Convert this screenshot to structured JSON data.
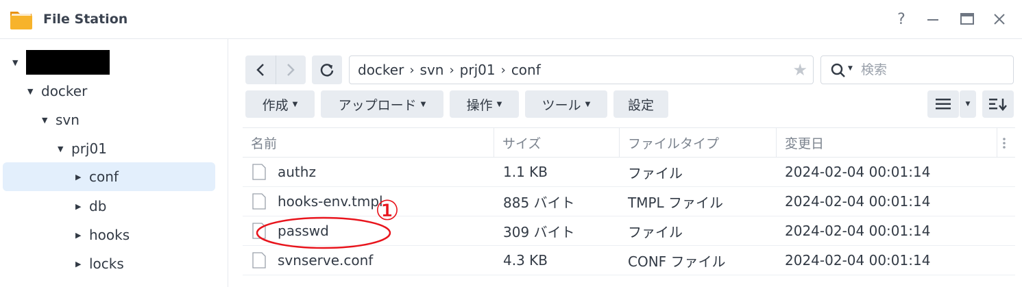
{
  "app": {
    "title": "File Station"
  },
  "window_controls": {
    "help": "?",
    "minimize": "—",
    "maximize": "□",
    "close": "✕"
  },
  "sidebar": {
    "root_label": "",
    "items": [
      {
        "label": "docker"
      },
      {
        "label": "svn"
      },
      {
        "label": "prj01"
      },
      {
        "label": "conf"
      },
      {
        "label": "db"
      },
      {
        "label": "hooks"
      },
      {
        "label": "locks"
      }
    ]
  },
  "path": {
    "segments": [
      "docker",
      "svn",
      "prj01",
      "conf"
    ]
  },
  "search": {
    "placeholder": "検索"
  },
  "toolbar": {
    "create": "作成",
    "upload": "アップロード",
    "action": "操作",
    "tools": "ツール",
    "settings": "設定"
  },
  "table": {
    "headers": {
      "name": "名前",
      "size": "サイズ",
      "type": "ファイルタイプ",
      "modified": "変更日"
    },
    "rows": [
      {
        "name": "authz",
        "size": "1.1 KB",
        "type": "ファイル",
        "modified": "2024-02-04 00:01:14"
      },
      {
        "name": "hooks-env.tmpl",
        "size": "885 バイト",
        "type": "TMPL ファイル",
        "modified": "2024-02-04 00:01:14"
      },
      {
        "name": "passwd",
        "size": "309 バイト",
        "type": "ファイル",
        "modified": "2024-02-04 00:01:14"
      },
      {
        "name": "svnserve.conf",
        "size": "4.3 KB",
        "type": "CONF ファイル",
        "modified": "2024-02-04 00:01:14"
      }
    ]
  },
  "annotation": {
    "marker": "①"
  },
  "colors": {
    "accent": "#e3effc",
    "annotation": "#e8141c",
    "folder": "#f5a623"
  }
}
